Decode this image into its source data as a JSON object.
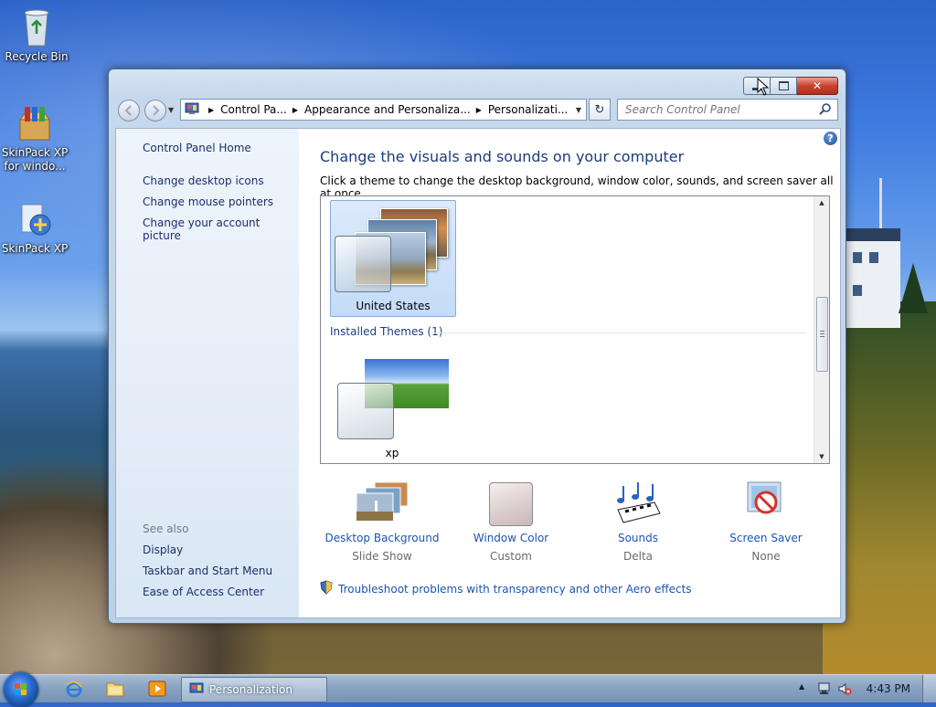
{
  "desktop": {
    "icons": [
      {
        "label": "Recycle Bin",
        "icon": "recycle-bin-icon"
      },
      {
        "label": "SkinPack XP for windo...",
        "icon": "package-icon"
      },
      {
        "label": "SkinPack XP",
        "icon": "installer-icon"
      }
    ]
  },
  "window": {
    "title": "Personalization",
    "controls": {
      "minimize": "minimize-icon",
      "maximize": "maximize-icon",
      "close": "close-icon"
    },
    "address": {
      "crumbs": [
        "Control Pa...",
        "Appearance and Personaliza...",
        "Personalizati..."
      ]
    },
    "search": {
      "placeholder": "Search Control Panel"
    },
    "sidebar": {
      "home": "Control Panel Home",
      "links": [
        "Change desktop icons",
        "Change mouse pointers",
        "Change your account picture"
      ],
      "see_also_label": "See also",
      "see_also": [
        "Display",
        "Taskbar and Start Menu",
        "Ease of Access Center"
      ]
    },
    "main": {
      "heading": "Change the visuals and sounds on your computer",
      "subtitle": "Click a theme to change the desktop background, window color, sounds, and screen saver all at once.",
      "themes": {
        "selected": "United States",
        "installed_header": "Installed Themes (1)",
        "installed": [
          "xp"
        ]
      },
      "settings": [
        {
          "title": "Desktop Background",
          "value": "Slide Show"
        },
        {
          "title": "Window Color",
          "value": "Custom"
        },
        {
          "title": "Sounds",
          "value": "Delta"
        },
        {
          "title": "Screen Saver",
          "value": "None"
        }
      ],
      "troubleshoot": "Troubleshoot problems with transparency and other Aero effects"
    }
  },
  "taskbar": {
    "task": "Personalization",
    "clock": "4:43 PM",
    "pinned": [
      "internet-explorer-icon",
      "folder-icon",
      "media-player-icon"
    ]
  },
  "colors": {
    "link": "#1c54b4",
    "heading": "#1c3c7c",
    "close_red": "#c9432d"
  }
}
